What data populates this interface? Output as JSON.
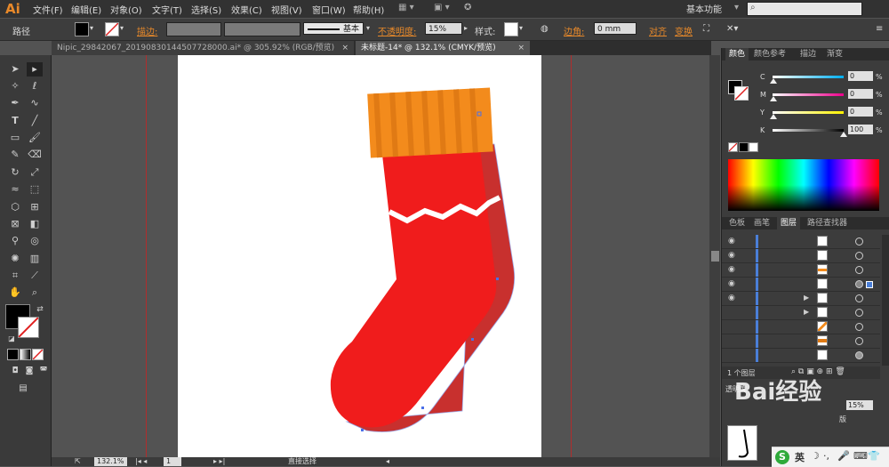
{
  "app": {
    "logo": "Ai",
    "workspace": "基本功能"
  },
  "menu": [
    "文件(F)",
    "编辑(E)",
    "对象(O)",
    "文字(T)",
    "选择(S)",
    "效果(C)",
    "视图(V)",
    "窗口(W)",
    "帮助(H)"
  ],
  "control": {
    "object_type": "路径",
    "stroke_label": "描边:",
    "brush_label": "基本",
    "opacity_label": "不透明度:",
    "opacity_value": "15%",
    "style_label": "样式:",
    "corner_label": "边角:",
    "corner_value": "0 mm",
    "align_label": "对齐",
    "transform_label": "变换"
  },
  "tabs": [
    {
      "label": "Nipic_29842067_20190830144507728000.ai* @ 305.92% (RGB/预览)"
    },
    {
      "label": "未标题-14* @ 132.1% (CMYK/预览)"
    }
  ],
  "tab_close": "×",
  "status": {
    "zoom": "132.1%",
    "page": "1",
    "tool": "直接选择"
  },
  "panels": {
    "color_tabs": [
      "颜色",
      "颜色参考",
      "描边",
      "渐变"
    ],
    "sliders": [
      {
        "label": "C",
        "value": "0",
        "pct": "%",
        "level": 0
      },
      {
        "label": "M",
        "value": "0",
        "pct": "%",
        "level": 0
      },
      {
        "label": "Y",
        "value": "0",
        "pct": "%",
        "level": 0
      },
      {
        "label": "K",
        "value": "100",
        "pct": "%",
        "level": 100
      }
    ],
    "layer_tabs": [
      "色板",
      "画笔",
      "图层",
      "路径查找器"
    ],
    "layer_count": "1 个图层",
    "transparency_label": "透明度",
    "transparency_value": "15%",
    "blend_label": "版"
  },
  "colors": {
    "accent": "#e8892a",
    "sock_red": "#f01c1c",
    "sock_shadow": "#c8302e",
    "cuff_orange": "#f38b1c",
    "cuff_stripe": "#e07a14",
    "zigzag": "#ffffff"
  },
  "watermark": "Bai经验",
  "ime": {
    "icon": "S",
    "lang": "英"
  }
}
